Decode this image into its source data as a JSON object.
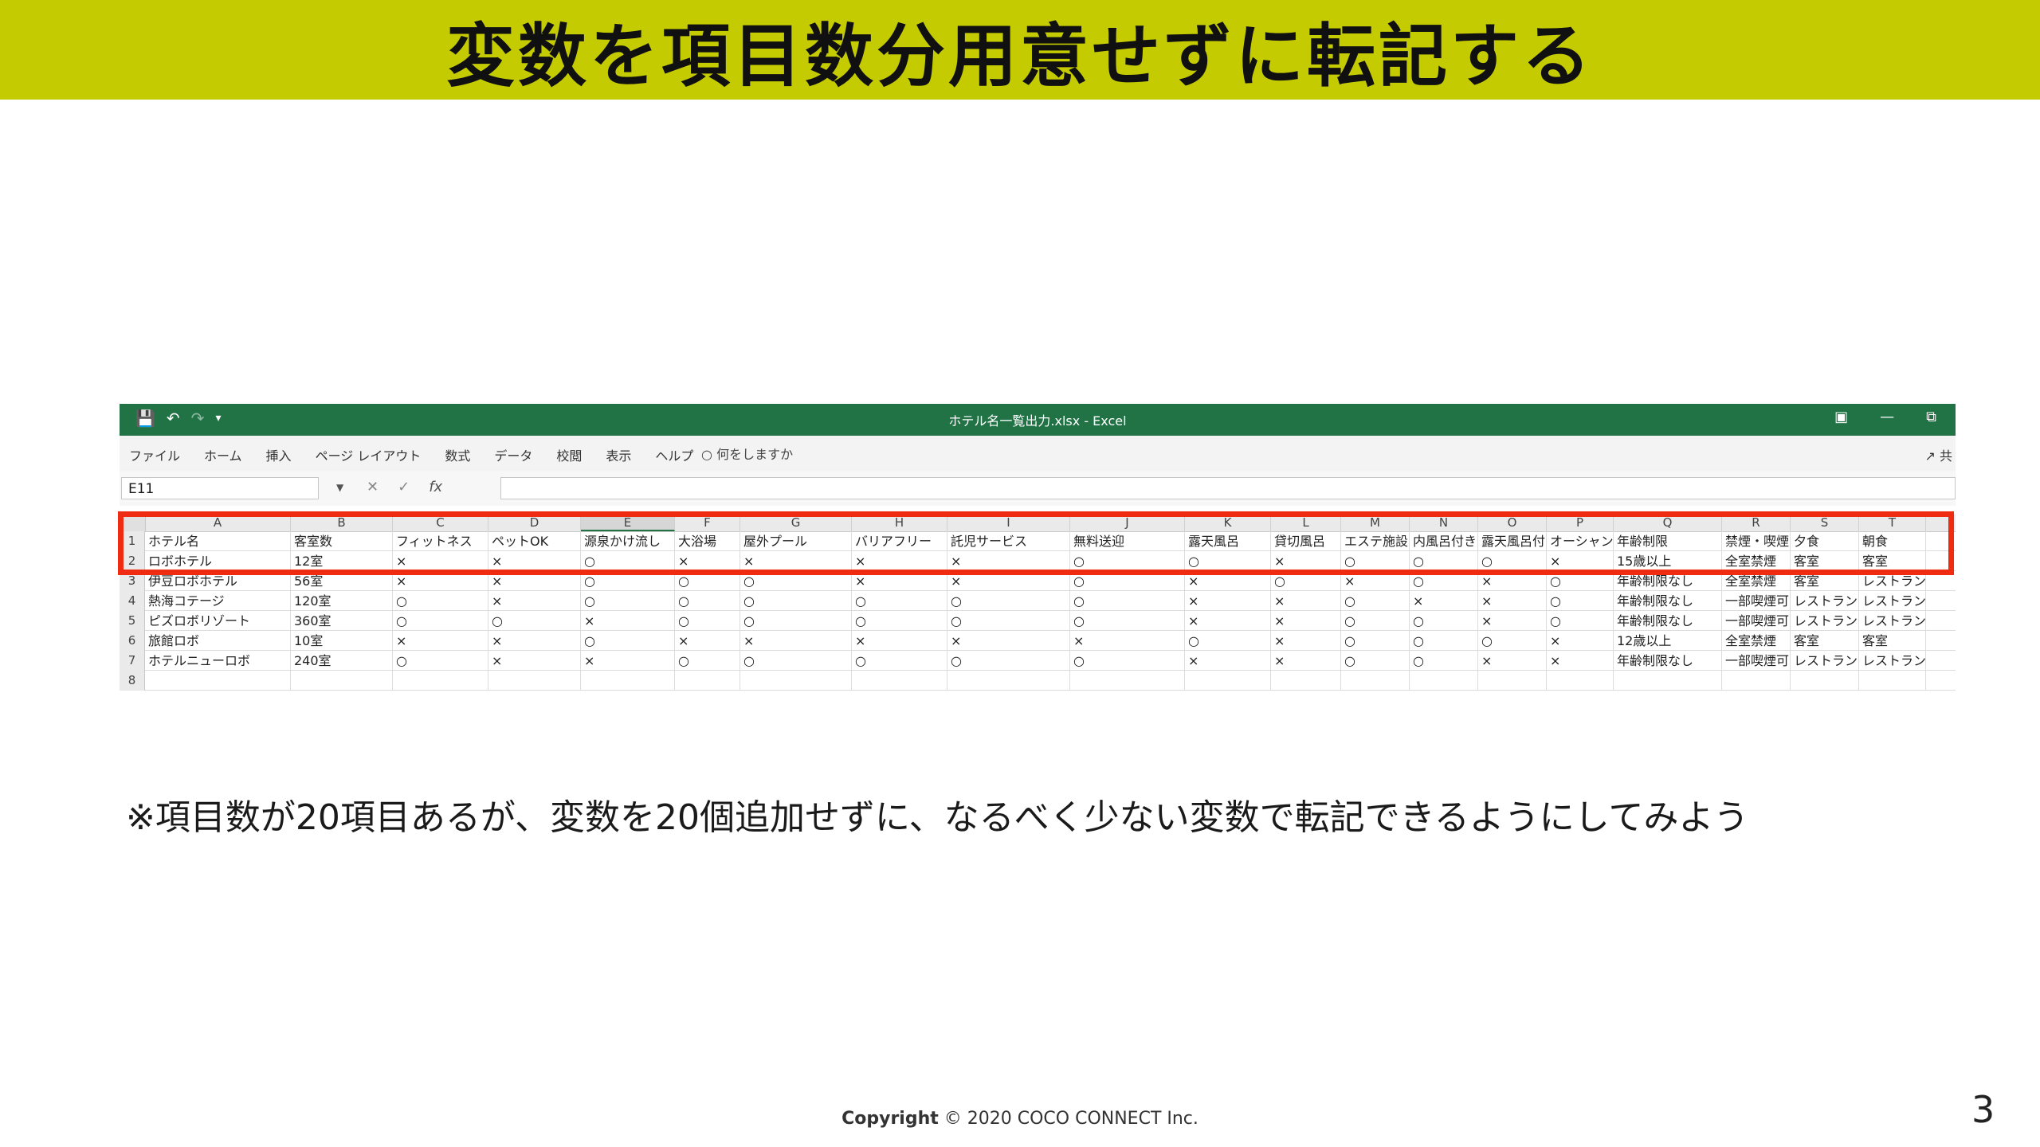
{
  "slide": {
    "title": "変数を項目数分用意せずに転記する",
    "note": "※項目数が20項目あるが、変数を20個追加せずに、なるべく少ない変数で転記できるようにしてみよう",
    "copyright_label": "Copyright",
    "copyright_text": "© 2020 COCO CONNECT Inc.",
    "page_number": "3",
    "title_bar_color": "#c4cb00",
    "highlight_color": "#ef2b12"
  },
  "excel": {
    "window_title": "ホテル名一覧出力.xlsx  -  Excel",
    "menu": [
      "ファイル",
      "ホーム",
      "挿入",
      "ページ レイアウト",
      "数式",
      "データ",
      "校閲",
      "表示",
      "ヘルプ"
    ],
    "tell_me": "何をしますか",
    "share": "共",
    "name_box": "E11",
    "fx_label": "fx",
    "column_letters": [
      "A",
      "B",
      "C",
      "D",
      "E",
      "F",
      "G",
      "H",
      "I",
      "J",
      "K",
      "L",
      "M",
      "N",
      "O",
      "P",
      "Q",
      "R",
      "S",
      "T"
    ],
    "row_numbers": [
      "1",
      "2",
      "3",
      "4",
      "5",
      "6",
      "7",
      "8"
    ],
    "header_row": [
      "ホテル名",
      "客室数",
      "フィットネス",
      "ペットOK",
      "源泉かけ流し",
      "大浴場",
      "屋外プール",
      "バリアフリー",
      "託児サービス",
      "無料送迎",
      "露天風呂",
      "貸切風呂",
      "エステ施設",
      "内風呂付き",
      "露天風呂付",
      "オーシャン",
      "年齢制限",
      "禁煙・喫煙",
      "夕食",
      "朝食"
    ],
    "rows": [
      [
        "ロボホテル",
        "12室",
        "×",
        "×",
        "○",
        "×",
        "×",
        "×",
        "×",
        "○",
        "○",
        "×",
        "○",
        "○",
        "○",
        "×",
        "15歳以上",
        "全室禁煙",
        "客室",
        "客室"
      ],
      [
        "伊豆ロボホテル",
        "56室",
        "×",
        "×",
        "○",
        "○",
        "○",
        "×",
        "×",
        "○",
        "×",
        "○",
        "×",
        "○",
        "×",
        "○",
        "年齢制限なし",
        "全室禁煙",
        "客室",
        "レストラン"
      ],
      [
        "熱海コテージ",
        "120室",
        "○",
        "×",
        "○",
        "○",
        "○",
        "○",
        "○",
        "○",
        "×",
        "×",
        "○",
        "×",
        "×",
        "○",
        "年齢制限なし",
        "一部喫煙可",
        "レストラン",
        "レストラン"
      ],
      [
        "ピズロボリゾート",
        "360室",
        "○",
        "○",
        "×",
        "○",
        "○",
        "○",
        "○",
        "○",
        "×",
        "×",
        "○",
        "○",
        "×",
        "○",
        "年齢制限なし",
        "一部喫煙可",
        "レストラン",
        "レストラン"
      ],
      [
        "旅館ロボ",
        "10室",
        "×",
        "×",
        "○",
        "×",
        "×",
        "×",
        "×",
        "×",
        "○",
        "×",
        "○",
        "○",
        "○",
        "×",
        "12歳以上",
        "全室禁煙",
        "客室",
        "客室"
      ],
      [
        "ホテルニューロボ",
        "240室",
        "○",
        "×",
        "×",
        "○",
        "○",
        "○",
        "○",
        "○",
        "×",
        "×",
        "○",
        "○",
        "×",
        "×",
        "年齢制限なし",
        "一部喫煙可",
        "レストラン",
        "レストラン"
      ]
    ]
  }
}
